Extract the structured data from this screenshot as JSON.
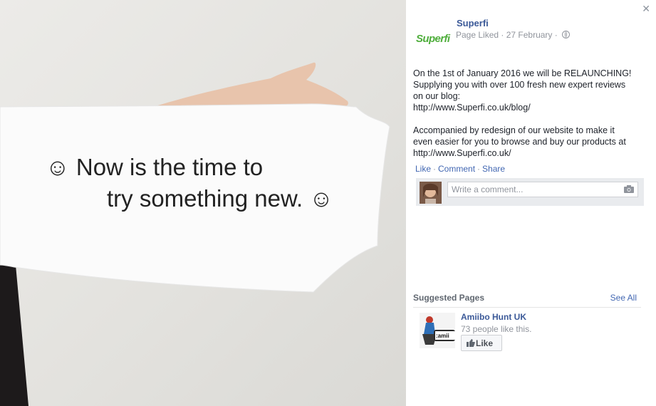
{
  "photo": {
    "line1": "☺ Now is the time to",
    "line2": "try something new. ☺"
  },
  "panel": {
    "close_label": "✕",
    "logo_text": "Superfi",
    "page_name": "Superfi",
    "meta": "Page Liked · 27 February ·",
    "post_paragraph1_lines": [
      "On the 1st of January 2016 we will be RELAUNCHING!",
      "Supplying you with over 100 fresh new expert reviews",
      "on our blog:",
      "http://www.Superfi.co.uk/blog/"
    ],
    "post_paragraph2_lines": [
      "Accompanied by redesign of our website to make it",
      "even easier for you to browse and buy our products at",
      "http://www.Superfi.co.uk/"
    ],
    "actions": {
      "like": "Like",
      "comment": "Comment",
      "share": "Share",
      "separator": "·"
    },
    "comment": {
      "placeholder": "Write a comment...",
      "value": ""
    },
    "suggested": {
      "title": "Suggested Pages",
      "see_all": "See All",
      "page_name": "Amiibo Hunt UK",
      "likes": "73 people like this.",
      "like_button": "Like",
      "thumb_text": ":amii"
    }
  },
  "colors": {
    "link": "#3b5998",
    "action": "#4267b2",
    "logo_green": "#4fae3c",
    "muted": "#90949c"
  },
  "icons": [
    "close-icon",
    "globe-icon",
    "camera-icon",
    "thumbs-up-icon"
  ]
}
